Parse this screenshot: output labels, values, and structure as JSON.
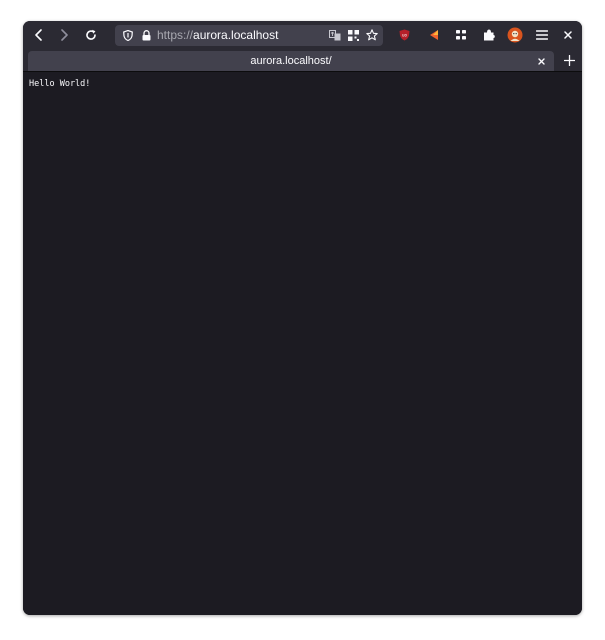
{
  "browser": {
    "nav": {
      "back_icon": "chevron-left-icon",
      "forward_icon": "chevron-right-icon",
      "reload_icon": "reload-icon"
    },
    "urlbar": {
      "scheme": "https://",
      "host": "aurora.localhost",
      "icons": [
        "shield-icon",
        "lock-icon",
        "translate-icon",
        "qr-code-icon",
        "star-icon"
      ]
    },
    "extensions": [
      "ublock-origin-icon",
      "extension-arrow-icon",
      "apps-grid-icon",
      "puzzle-piece-icon",
      "profile-avatar-icon"
    ],
    "menu_icon": "hamburger-menu-icon",
    "close_icon": "close-icon",
    "tab": {
      "title": "aurora.localhost/",
      "close_icon": "close-icon"
    },
    "new_tab_icon": "plus-icon"
  },
  "page": {
    "text": "Hello World!"
  },
  "colors": {
    "toolbar": "#2b2a33",
    "urlbar": "#42414d",
    "content_bg": "#1c1b22",
    "text": "#fbfbfe",
    "ublock_red": "#b5202a",
    "avatar_orange": "#d9541e"
  }
}
